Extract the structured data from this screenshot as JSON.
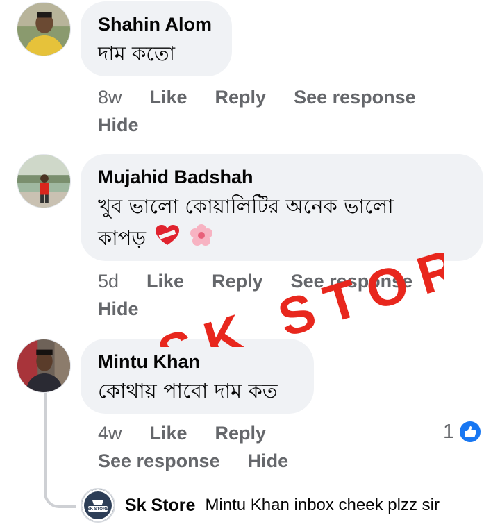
{
  "comments": [
    {
      "author": "Shahin Alom",
      "text": "দাম কতো",
      "time": "8w",
      "like": "Like",
      "reply": "Reply",
      "see_response": "See response",
      "hide": "Hide",
      "avatar_icon": "person-yellow-shirt"
    },
    {
      "author": "Mujahid Badshah",
      "text_line1": "খুব ভালো কোয়ালিটির অনেক ভালো",
      "text_line2": "কাপড়",
      "emojis": [
        "heart-bandaged-emoji",
        "cherry-blossom-emoji"
      ],
      "time": "5d",
      "like": "Like",
      "reply": "Reply",
      "see_response": "See response",
      "hide": "Hide",
      "avatar_icon": "person-red-shirt"
    },
    {
      "author": "Mintu Khan",
      "text": "কোথায় পাবো দাম কত",
      "time": "4w",
      "like": "Like",
      "reply": "Reply",
      "see_response": "See response",
      "hide": "Hide",
      "reaction_count": "1",
      "avatar_icon": "person-dark-shirt"
    }
  ],
  "reply": {
    "author": "Sk Store",
    "text": "Mintu Khan inbox cheek plzz sir",
    "avatar_label": "SK STORE"
  },
  "watermark": {
    "text": "SK STORE",
    "color": "#e8271d"
  },
  "colors": {
    "bubble": "#f0f2f5",
    "secondary_text": "#65676b",
    "like_blue": "#1877f2"
  }
}
